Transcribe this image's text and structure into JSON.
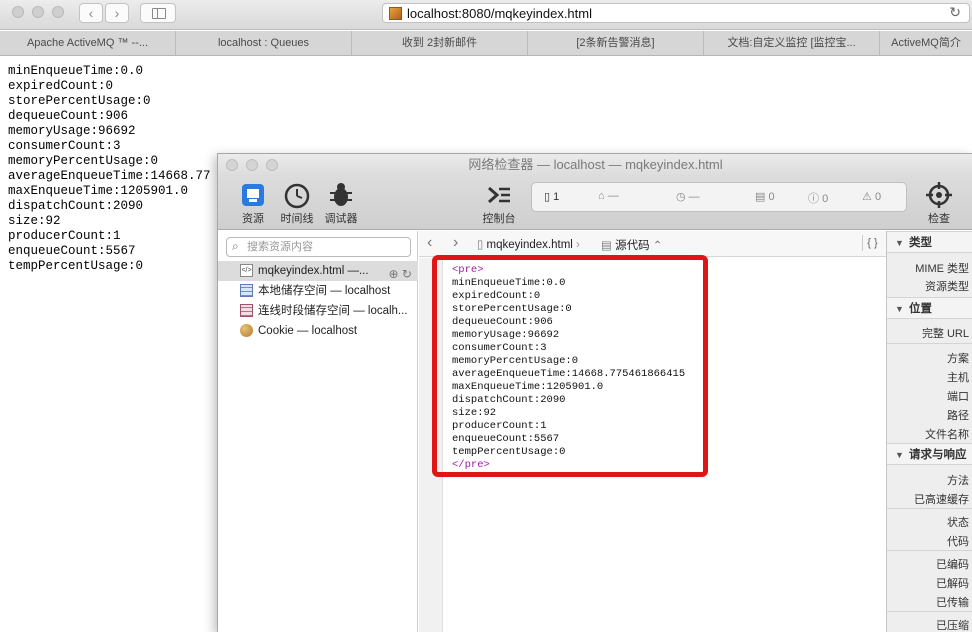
{
  "browser": {
    "url": "localhost:8080/mqkeyindex.html",
    "tabs": [
      {
        "label": "Apache ActiveMQ ™ --..."
      },
      {
        "label": "localhost : Queues"
      },
      {
        "label": "收到 2封新邮件"
      },
      {
        "label": "[2条新告警消息]"
      },
      {
        "label": "文档:自定义监控 [监控宝..."
      },
      {
        "label": "ActiveMQ简介"
      }
    ]
  },
  "page_lines": [
    "minEnqueueTime:0.0",
    "expiredCount:0",
    "storePercentUsage:0",
    "dequeueCount:906",
    "memoryUsage:96692",
    "consumerCount:3",
    "memoryPercentUsage:0",
    "averageEnqueueTime:14668.77",
    "maxEnqueueTime:1205901.0",
    "dispatchCount:2090",
    "size:92",
    "producerCount:1",
    "enqueueCount:5567",
    "tempPercentUsage:0"
  ],
  "inspector": {
    "title": "网络检查器 — localhost — mqkeyindex.html",
    "toolbar": {
      "resources": "资源",
      "timeline": "时间线",
      "debugger": "调试器",
      "console": "控制台",
      "inspect": "检查"
    },
    "activity": {
      "resources_count": "1",
      "dash1": "—",
      "dash2": "—",
      "logs": "0",
      "errors": "0",
      "warnings": "0"
    },
    "filter_placeholder": "搜索资源内容",
    "resources": [
      {
        "label": "mqkeyindex.html —..."
      },
      {
        "label": "本地储存空间 — localhost"
      },
      {
        "label": "连线时段储存空间 — localh..."
      },
      {
        "label": "Cookie — localhost"
      }
    ],
    "breadcrumb": {
      "file": "mqkeyindex.html",
      "mode": "源代码",
      "braces": "{ }"
    },
    "source": {
      "open_tag": "<pre>",
      "lines": [
        "minEnqueueTime:0.0",
        "expiredCount:0",
        "storePercentUsage:0",
        "dequeueCount:906",
        "memoryUsage:96692",
        "consumerCount:3",
        "memoryPercentUsage:0",
        "averageEnqueueTime:14668.775461866415",
        "maxEnqueueTime:1205901.0",
        "dispatchCount:2090",
        "size:92",
        "producerCount:1",
        "enqueueCount:5567",
        "tempPercentUsage:0"
      ],
      "close_tag": "</pre>"
    },
    "details": {
      "type_head": "类型",
      "mime": "MIME 类型",
      "res_type": "资源类型",
      "location_head": "位置",
      "full_url": "完整 URL",
      "scheme": "方案",
      "host": "主机",
      "port": "端口",
      "path": "路径",
      "filename": "文件名称",
      "reqres_head": "请求与响应",
      "method": "方法",
      "cached": "已高速缓存",
      "status": "状态",
      "code": "代码",
      "encoded": "已编码",
      "decoded": "已解码",
      "transferred": "已传输",
      "compressed": "已压缩"
    },
    "highlight_color": "#e01515"
  }
}
